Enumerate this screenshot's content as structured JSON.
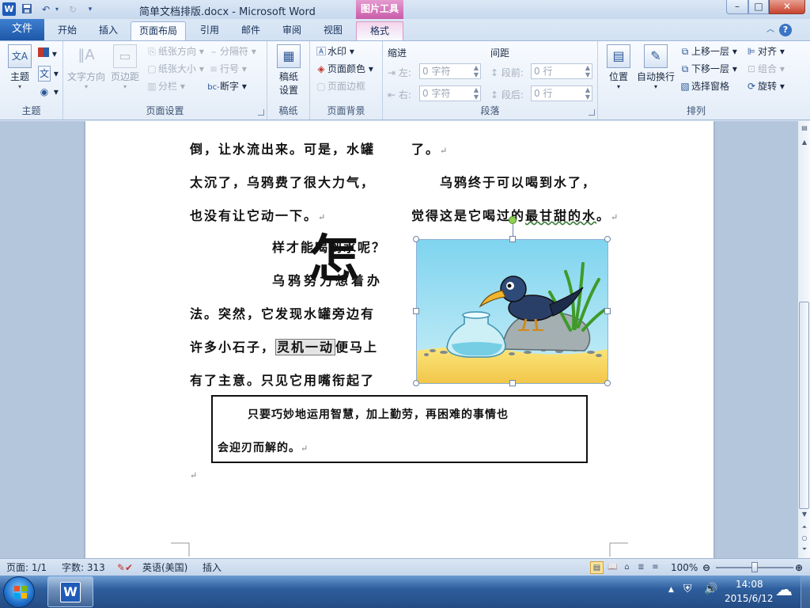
{
  "app": {
    "document_title": "简单文档排版.docx - Microsoft Word",
    "context_tool": "图片工具",
    "window_controls": {
      "minimize": "–",
      "maximize": "□",
      "close": "✕"
    }
  },
  "tabs": [
    {
      "label": "文件"
    },
    {
      "label": "开始"
    },
    {
      "label": "插入"
    },
    {
      "label": "页面布局"
    },
    {
      "label": "引用"
    },
    {
      "label": "邮件"
    },
    {
      "label": "审阅"
    },
    {
      "label": "视图"
    },
    {
      "label": "格式"
    }
  ],
  "ribbon": {
    "groups": {
      "theme": "主题",
      "page_setup": "页面设置",
      "manuscript": "稿纸",
      "page_background": "页面背景",
      "paragraph": "段落",
      "arrange": "排列"
    },
    "theme": {
      "button": "主题"
    },
    "page_setup": {
      "text_direction": "文字方向",
      "margins": "页边距",
      "orientation": "纸张方向",
      "size": "纸张大小",
      "columns": "分栏",
      "breaks": "分隔符",
      "line_numbers": "行号",
      "hyphenation": "断字"
    },
    "manuscript": {
      "button_line1": "稿纸",
      "button_line2": "设置"
    },
    "page_background": {
      "watermark": "水印",
      "page_color": "页面颜色",
      "page_borders": "页面边框"
    },
    "paragraph": {
      "indent": "缩进",
      "spacing": "间距",
      "left_label": "左:",
      "right_label": "右:",
      "before_label": "段前:",
      "after_label": "段后:",
      "left_value": "0 字符",
      "right_value": "0 字符",
      "before_value": "0 行",
      "after_value": "0 行"
    },
    "arrange": {
      "position": "位置",
      "wrap_text": "自动换行",
      "bring_forward": "上移一层",
      "send_backward": "下移一层",
      "selection_pane": "选择窗格",
      "align": "对齐",
      "group": "组合",
      "rotate": "旋转"
    }
  },
  "document": {
    "lines": {
      "l1": "倒，让水流出来。可是，水罐",
      "l1b": "了。",
      "l2": "太沉了，乌鸦费了很大力气，",
      "l2b": "乌鸦终于可以喝到水了，",
      "l3": "也没有让它动一下。",
      "l3b_1": "觉得这是它喝过的",
      "l3b_2": "最甘甜的水",
      "l3b_3": "。",
      "drop_cap": "怎",
      "l4": "样才能喝到水呢？",
      "l5": "乌鸦努力想着办",
      "l6": "法。突然，它发现水罐旁边有",
      "l7a": "许多小石子，",
      "l7_selected": "灵机一动",
      "l7b": "便马上",
      "l8": "有了主意。只见它用嘴衔起了",
      "para_mark": "↵"
    },
    "textbox": {
      "line1": "只要巧妙地运用智慧，加上勤劳，再困难的事情也",
      "line2": "会迎刃而解的。"
    }
  },
  "status": {
    "page": "页面: 1/1",
    "words": "字数: 313",
    "language": "英语(美国)",
    "mode": "插入",
    "zoom": "100%",
    "zoom_level_percent": 100
  },
  "taskbar": {
    "time": "14:08",
    "date": "2015/6/12"
  },
  "colors": {
    "file_tab": "#1d57a8",
    "picture_tools": "#c95ca9",
    "selection_highlight": "#e4e4e4"
  }
}
